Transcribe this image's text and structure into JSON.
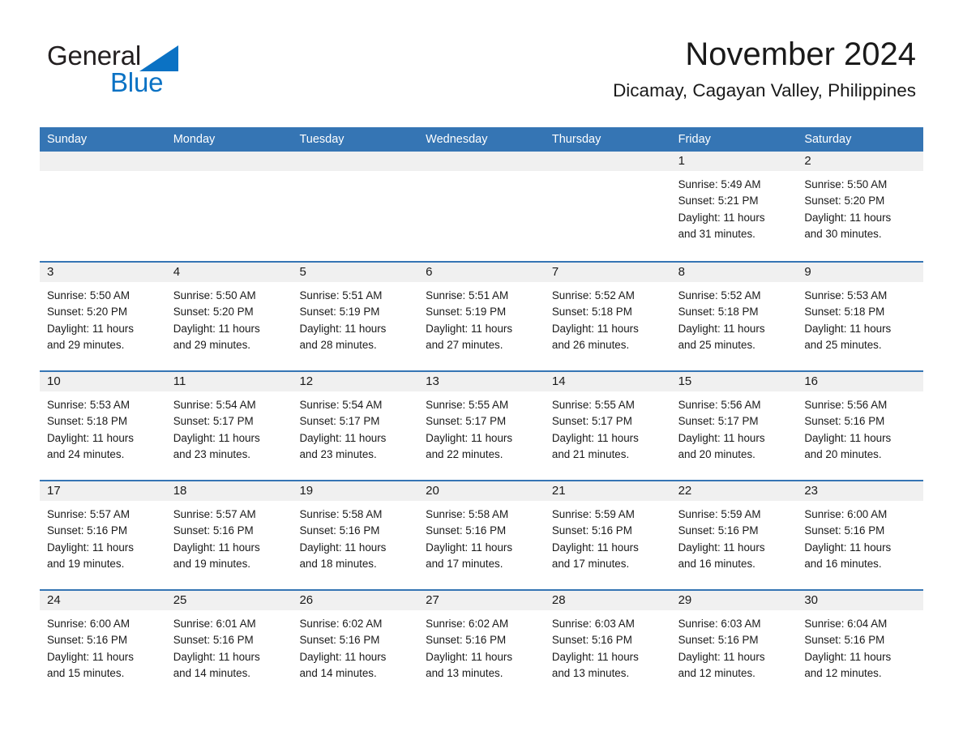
{
  "brand": {
    "name_part1": "General",
    "name_part2": "Blue",
    "accent_color": "#0b72c4"
  },
  "header": {
    "month_title": "November 2024",
    "location": "Dicamay, Cagayan Valley, Philippines",
    "header_bar_color": "#3575b4"
  },
  "calendar": {
    "weekday_headers": [
      "Sunday",
      "Monday",
      "Tuesday",
      "Wednesday",
      "Thursday",
      "Friday",
      "Saturday"
    ],
    "weeks": [
      [
        {
          "day": "",
          "sunrise": "",
          "sunset": "",
          "daylight_line1": "",
          "daylight_line2": ""
        },
        {
          "day": "",
          "sunrise": "",
          "sunset": "",
          "daylight_line1": "",
          "daylight_line2": ""
        },
        {
          "day": "",
          "sunrise": "",
          "sunset": "",
          "daylight_line1": "",
          "daylight_line2": ""
        },
        {
          "day": "",
          "sunrise": "",
          "sunset": "",
          "daylight_line1": "",
          "daylight_line2": ""
        },
        {
          "day": "",
          "sunrise": "",
          "sunset": "",
          "daylight_line1": "",
          "daylight_line2": ""
        },
        {
          "day": "1",
          "sunrise": "Sunrise: 5:49 AM",
          "sunset": "Sunset: 5:21 PM",
          "daylight_line1": "Daylight: 11 hours",
          "daylight_line2": "and 31 minutes."
        },
        {
          "day": "2",
          "sunrise": "Sunrise: 5:50 AM",
          "sunset": "Sunset: 5:20 PM",
          "daylight_line1": "Daylight: 11 hours",
          "daylight_line2": "and 30 minutes."
        }
      ],
      [
        {
          "day": "3",
          "sunrise": "Sunrise: 5:50 AM",
          "sunset": "Sunset: 5:20 PM",
          "daylight_line1": "Daylight: 11 hours",
          "daylight_line2": "and 29 minutes."
        },
        {
          "day": "4",
          "sunrise": "Sunrise: 5:50 AM",
          "sunset": "Sunset: 5:20 PM",
          "daylight_line1": "Daylight: 11 hours",
          "daylight_line2": "and 29 minutes."
        },
        {
          "day": "5",
          "sunrise": "Sunrise: 5:51 AM",
          "sunset": "Sunset: 5:19 PM",
          "daylight_line1": "Daylight: 11 hours",
          "daylight_line2": "and 28 minutes."
        },
        {
          "day": "6",
          "sunrise": "Sunrise: 5:51 AM",
          "sunset": "Sunset: 5:19 PM",
          "daylight_line1": "Daylight: 11 hours",
          "daylight_line2": "and 27 minutes."
        },
        {
          "day": "7",
          "sunrise": "Sunrise: 5:52 AM",
          "sunset": "Sunset: 5:18 PM",
          "daylight_line1": "Daylight: 11 hours",
          "daylight_line2": "and 26 minutes."
        },
        {
          "day": "8",
          "sunrise": "Sunrise: 5:52 AM",
          "sunset": "Sunset: 5:18 PM",
          "daylight_line1": "Daylight: 11 hours",
          "daylight_line2": "and 25 minutes."
        },
        {
          "day": "9",
          "sunrise": "Sunrise: 5:53 AM",
          "sunset": "Sunset: 5:18 PM",
          "daylight_line1": "Daylight: 11 hours",
          "daylight_line2": "and 25 minutes."
        }
      ],
      [
        {
          "day": "10",
          "sunrise": "Sunrise: 5:53 AM",
          "sunset": "Sunset: 5:18 PM",
          "daylight_line1": "Daylight: 11 hours",
          "daylight_line2": "and 24 minutes."
        },
        {
          "day": "11",
          "sunrise": "Sunrise: 5:54 AM",
          "sunset": "Sunset: 5:17 PM",
          "daylight_line1": "Daylight: 11 hours",
          "daylight_line2": "and 23 minutes."
        },
        {
          "day": "12",
          "sunrise": "Sunrise: 5:54 AM",
          "sunset": "Sunset: 5:17 PM",
          "daylight_line1": "Daylight: 11 hours",
          "daylight_line2": "and 23 minutes."
        },
        {
          "day": "13",
          "sunrise": "Sunrise: 5:55 AM",
          "sunset": "Sunset: 5:17 PM",
          "daylight_line1": "Daylight: 11 hours",
          "daylight_line2": "and 22 minutes."
        },
        {
          "day": "14",
          "sunrise": "Sunrise: 5:55 AM",
          "sunset": "Sunset: 5:17 PM",
          "daylight_line1": "Daylight: 11 hours",
          "daylight_line2": "and 21 minutes."
        },
        {
          "day": "15",
          "sunrise": "Sunrise: 5:56 AM",
          "sunset": "Sunset: 5:17 PM",
          "daylight_line1": "Daylight: 11 hours",
          "daylight_line2": "and 20 minutes."
        },
        {
          "day": "16",
          "sunrise": "Sunrise: 5:56 AM",
          "sunset": "Sunset: 5:16 PM",
          "daylight_line1": "Daylight: 11 hours",
          "daylight_line2": "and 20 minutes."
        }
      ],
      [
        {
          "day": "17",
          "sunrise": "Sunrise: 5:57 AM",
          "sunset": "Sunset: 5:16 PM",
          "daylight_line1": "Daylight: 11 hours",
          "daylight_line2": "and 19 minutes."
        },
        {
          "day": "18",
          "sunrise": "Sunrise: 5:57 AM",
          "sunset": "Sunset: 5:16 PM",
          "daylight_line1": "Daylight: 11 hours",
          "daylight_line2": "and 19 minutes."
        },
        {
          "day": "19",
          "sunrise": "Sunrise: 5:58 AM",
          "sunset": "Sunset: 5:16 PM",
          "daylight_line1": "Daylight: 11 hours",
          "daylight_line2": "and 18 minutes."
        },
        {
          "day": "20",
          "sunrise": "Sunrise: 5:58 AM",
          "sunset": "Sunset: 5:16 PM",
          "daylight_line1": "Daylight: 11 hours",
          "daylight_line2": "and 17 minutes."
        },
        {
          "day": "21",
          "sunrise": "Sunrise: 5:59 AM",
          "sunset": "Sunset: 5:16 PM",
          "daylight_line1": "Daylight: 11 hours",
          "daylight_line2": "and 17 minutes."
        },
        {
          "day": "22",
          "sunrise": "Sunrise: 5:59 AM",
          "sunset": "Sunset: 5:16 PM",
          "daylight_line1": "Daylight: 11 hours",
          "daylight_line2": "and 16 minutes."
        },
        {
          "day": "23",
          "sunrise": "Sunrise: 6:00 AM",
          "sunset": "Sunset: 5:16 PM",
          "daylight_line1": "Daylight: 11 hours",
          "daylight_line2": "and 16 minutes."
        }
      ],
      [
        {
          "day": "24",
          "sunrise": "Sunrise: 6:00 AM",
          "sunset": "Sunset: 5:16 PM",
          "daylight_line1": "Daylight: 11 hours",
          "daylight_line2": "and 15 minutes."
        },
        {
          "day": "25",
          "sunrise": "Sunrise: 6:01 AM",
          "sunset": "Sunset: 5:16 PM",
          "daylight_line1": "Daylight: 11 hours",
          "daylight_line2": "and 14 minutes."
        },
        {
          "day": "26",
          "sunrise": "Sunrise: 6:02 AM",
          "sunset": "Sunset: 5:16 PM",
          "daylight_line1": "Daylight: 11 hours",
          "daylight_line2": "and 14 minutes."
        },
        {
          "day": "27",
          "sunrise": "Sunrise: 6:02 AM",
          "sunset": "Sunset: 5:16 PM",
          "daylight_line1": "Daylight: 11 hours",
          "daylight_line2": "and 13 minutes."
        },
        {
          "day": "28",
          "sunrise": "Sunrise: 6:03 AM",
          "sunset": "Sunset: 5:16 PM",
          "daylight_line1": "Daylight: 11 hours",
          "daylight_line2": "and 13 minutes."
        },
        {
          "day": "29",
          "sunrise": "Sunrise: 6:03 AM",
          "sunset": "Sunset: 5:16 PM",
          "daylight_line1": "Daylight: 11 hours",
          "daylight_line2": "and 12 minutes."
        },
        {
          "day": "30",
          "sunrise": "Sunrise: 6:04 AM",
          "sunset": "Sunset: 5:16 PM",
          "daylight_line1": "Daylight: 11 hours",
          "daylight_line2": "and 12 minutes."
        }
      ]
    ]
  }
}
